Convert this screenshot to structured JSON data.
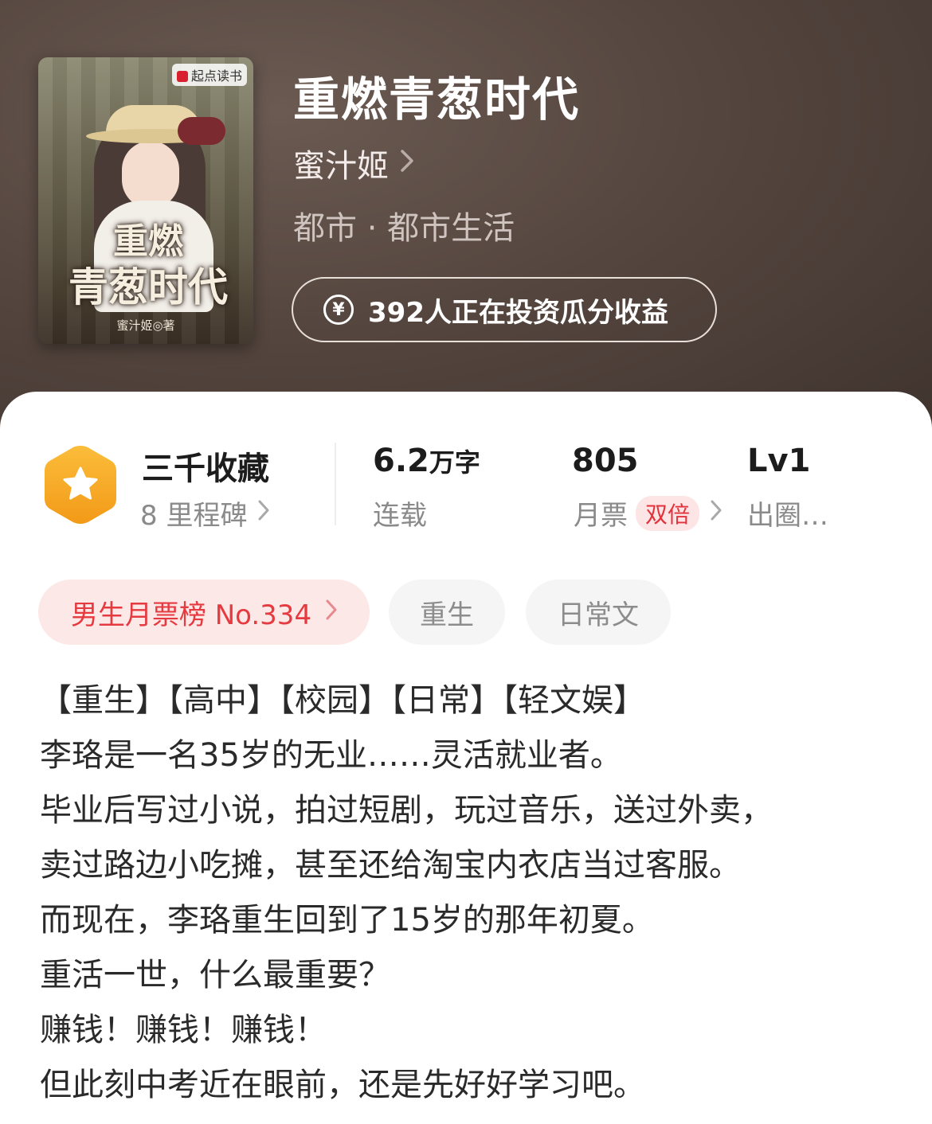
{
  "book": {
    "title": "重燃青葱时代",
    "author": "蜜汁姬",
    "genre": "都市 · 都市生活",
    "invest_text": "392人正在投资瓜分收益"
  },
  "cover": {
    "publisher": "起点读书",
    "title_line1": "重燃",
    "title_line2": "青葱时代",
    "author_line": "蜜汁姬◎著"
  },
  "stats": {
    "collect_main": "三千收藏",
    "collect_sub": "8 里程碑",
    "words_num": "6.2",
    "words_unit": "万字",
    "words_sub": "连载",
    "votes_main": "805",
    "votes_sub": "月票",
    "votes_badge": "双倍",
    "level_main": "Lv1",
    "level_sub": "出圈…"
  },
  "tags": {
    "rank": "男生月票榜 No.334",
    "tag1": "重生",
    "tag2": "日常文"
  },
  "description": [
    "【重生】【高中】【校园】【日常】【轻文娱】",
    "李珞是一名35岁的无业……灵活就业者。",
    "毕业后写过小说，拍过短剧，玩过音乐，送过外卖，",
    "卖过路边小吃摊，甚至还给淘宝内衣店当过客服。",
    "而现在，李珞重生回到了15岁的那年初夏。",
    "重活一世，什么最重要？",
    "赚钱！赚钱！赚钱！",
    "但此刻中考近在眼前，还是先好好学习吧。"
  ],
  "icons": {
    "collect": "star-hexagon-icon",
    "invest": "yen-coin-icon",
    "chevron": "chevron-right-icon"
  },
  "colors": {
    "header_bg": "#4f423c",
    "badge_gold": "#f6a623",
    "rank_red": "#e53a3f",
    "rank_bg": "#fde8e8"
  }
}
